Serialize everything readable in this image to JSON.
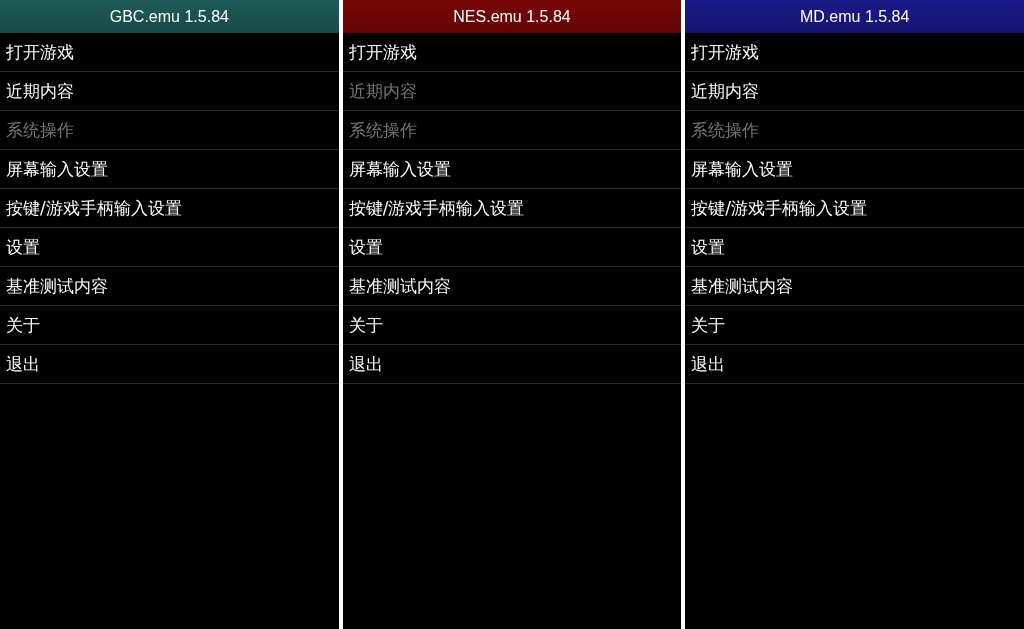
{
  "panels": [
    {
      "title": "GBC.emu 1.5.84",
      "color": "#1d5c57",
      "items": [
        {
          "label": "打开游戏",
          "disabled": false
        },
        {
          "label": "近期内容",
          "disabled": false
        },
        {
          "label": "系统操作",
          "disabled": true
        },
        {
          "label": "屏幕输入设置",
          "disabled": false
        },
        {
          "label": "按键/游戏手柄输入设置",
          "disabled": false
        },
        {
          "label": "设置",
          "disabled": false
        },
        {
          "label": "基准测试内容",
          "disabled": false
        },
        {
          "label": "关于",
          "disabled": false
        },
        {
          "label": "退出",
          "disabled": false
        }
      ]
    },
    {
      "title": "NES.emu 1.5.84",
      "color": "#7a0606",
      "items": [
        {
          "label": "打开游戏",
          "disabled": false
        },
        {
          "label": "近期内容",
          "disabled": true
        },
        {
          "label": "系统操作",
          "disabled": true
        },
        {
          "label": "屏幕输入设置",
          "disabled": false
        },
        {
          "label": "按键/游戏手柄输入设置",
          "disabled": false
        },
        {
          "label": "设置",
          "disabled": false
        },
        {
          "label": "基准测试内容",
          "disabled": false
        },
        {
          "label": "关于",
          "disabled": false
        },
        {
          "label": "退出",
          "disabled": false
        }
      ]
    },
    {
      "title": "MD.emu 1.5.84",
      "color": "#1a1a8a",
      "items": [
        {
          "label": "打开游戏",
          "disabled": false
        },
        {
          "label": "近期内容",
          "disabled": false
        },
        {
          "label": "系统操作",
          "disabled": true
        },
        {
          "label": "屏幕输入设置",
          "disabled": false
        },
        {
          "label": "按键/游戏手柄输入设置",
          "disabled": false
        },
        {
          "label": "设置",
          "disabled": false
        },
        {
          "label": "基准测试内容",
          "disabled": false
        },
        {
          "label": "关于",
          "disabled": false
        },
        {
          "label": "退出",
          "disabled": false
        }
      ]
    }
  ]
}
